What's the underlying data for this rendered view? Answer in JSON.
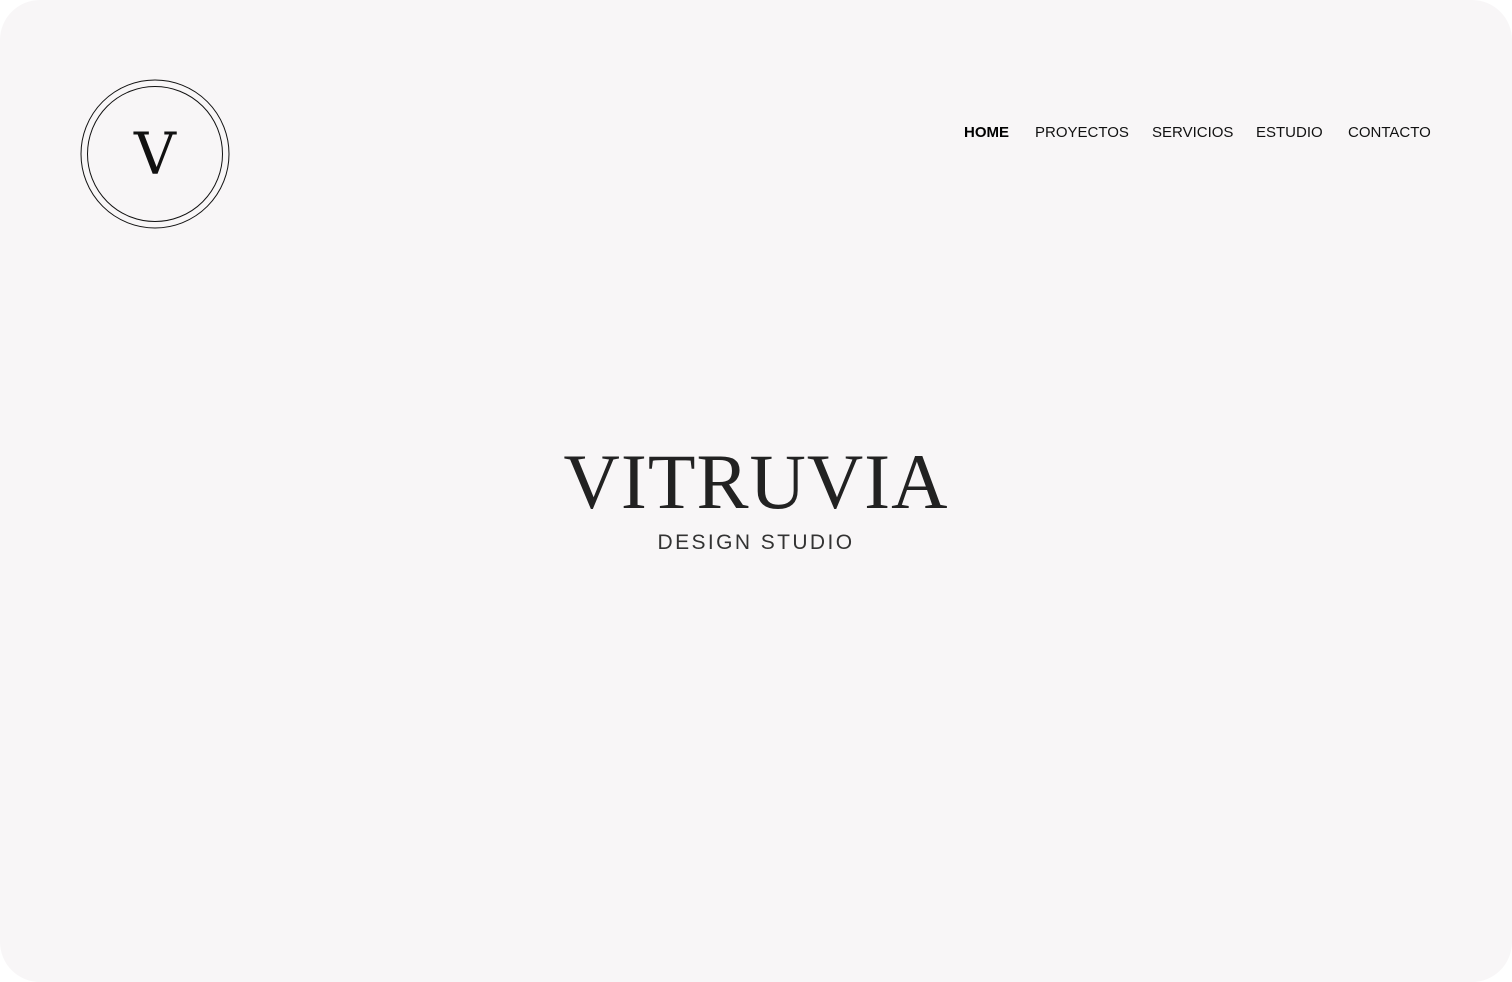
{
  "brand": {
    "monogram": "V",
    "name": "VITRUVIA",
    "tagline": "DESIGN STUDIO"
  },
  "nav": {
    "items": [
      {
        "label": "HOME",
        "active": true
      },
      {
        "label": "PROYECTOS",
        "active": false
      },
      {
        "label": "SERVICIOS",
        "active": false
      },
      {
        "label": "ESTUDIO",
        "active": false
      },
      {
        "label": "CONTACTO",
        "active": false
      }
    ]
  },
  "colors": {
    "background": "#f8f6f7",
    "text": "#111111",
    "title": "#222222"
  }
}
